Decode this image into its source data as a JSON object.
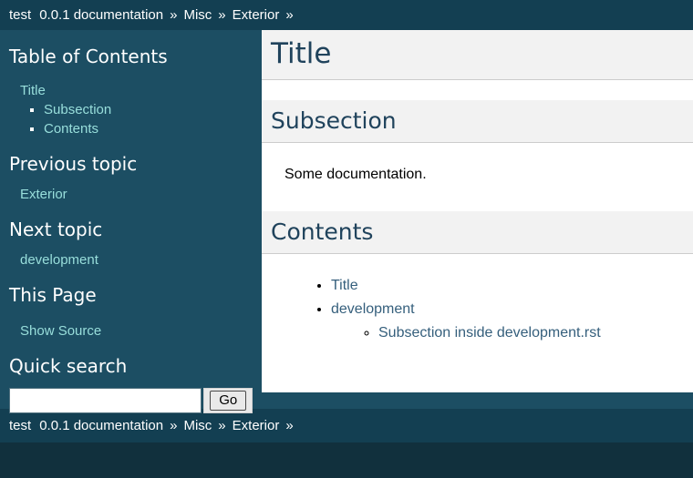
{
  "colors": {
    "page_bg": "#11303d",
    "relbar_bg": "#133f52",
    "sidebar_bg": "#1c4e63",
    "sidebar_link": "#98dedb",
    "sidebar_text": "#ffffff",
    "heading_text": "#20435c",
    "heading_band_bg": "#f2f2f2",
    "heading_band_border": "#cccccc",
    "content_link": "#355f7c",
    "body_bg": "#ffffff"
  },
  "relbar": {
    "project": "test",
    "docs": "0.0.1 documentation",
    "sep": "»",
    "crumb_misc": "Misc",
    "crumb_exterior": "Exterior"
  },
  "sidebar": {
    "toc_heading": "Table of Contents",
    "toc": {
      "root": "Title",
      "children": [
        "Subsection",
        "Contents"
      ]
    },
    "previous_heading": "Previous topic",
    "previous_link": "Exterior",
    "next_heading": "Next topic",
    "next_link": "development",
    "thispage_heading": "This Page",
    "show_source_link": "Show Source",
    "search_heading": "Quick search",
    "search_value": "",
    "go_label": "Go"
  },
  "content": {
    "title": "Title",
    "subsection_heading": "Subsection",
    "paragraph": "Some documentation.",
    "contents_heading": "Contents",
    "contents_list": [
      {
        "label": "Title",
        "children": []
      },
      {
        "label": "development",
        "children": [
          "Subsection inside development.rst"
        ]
      }
    ]
  }
}
